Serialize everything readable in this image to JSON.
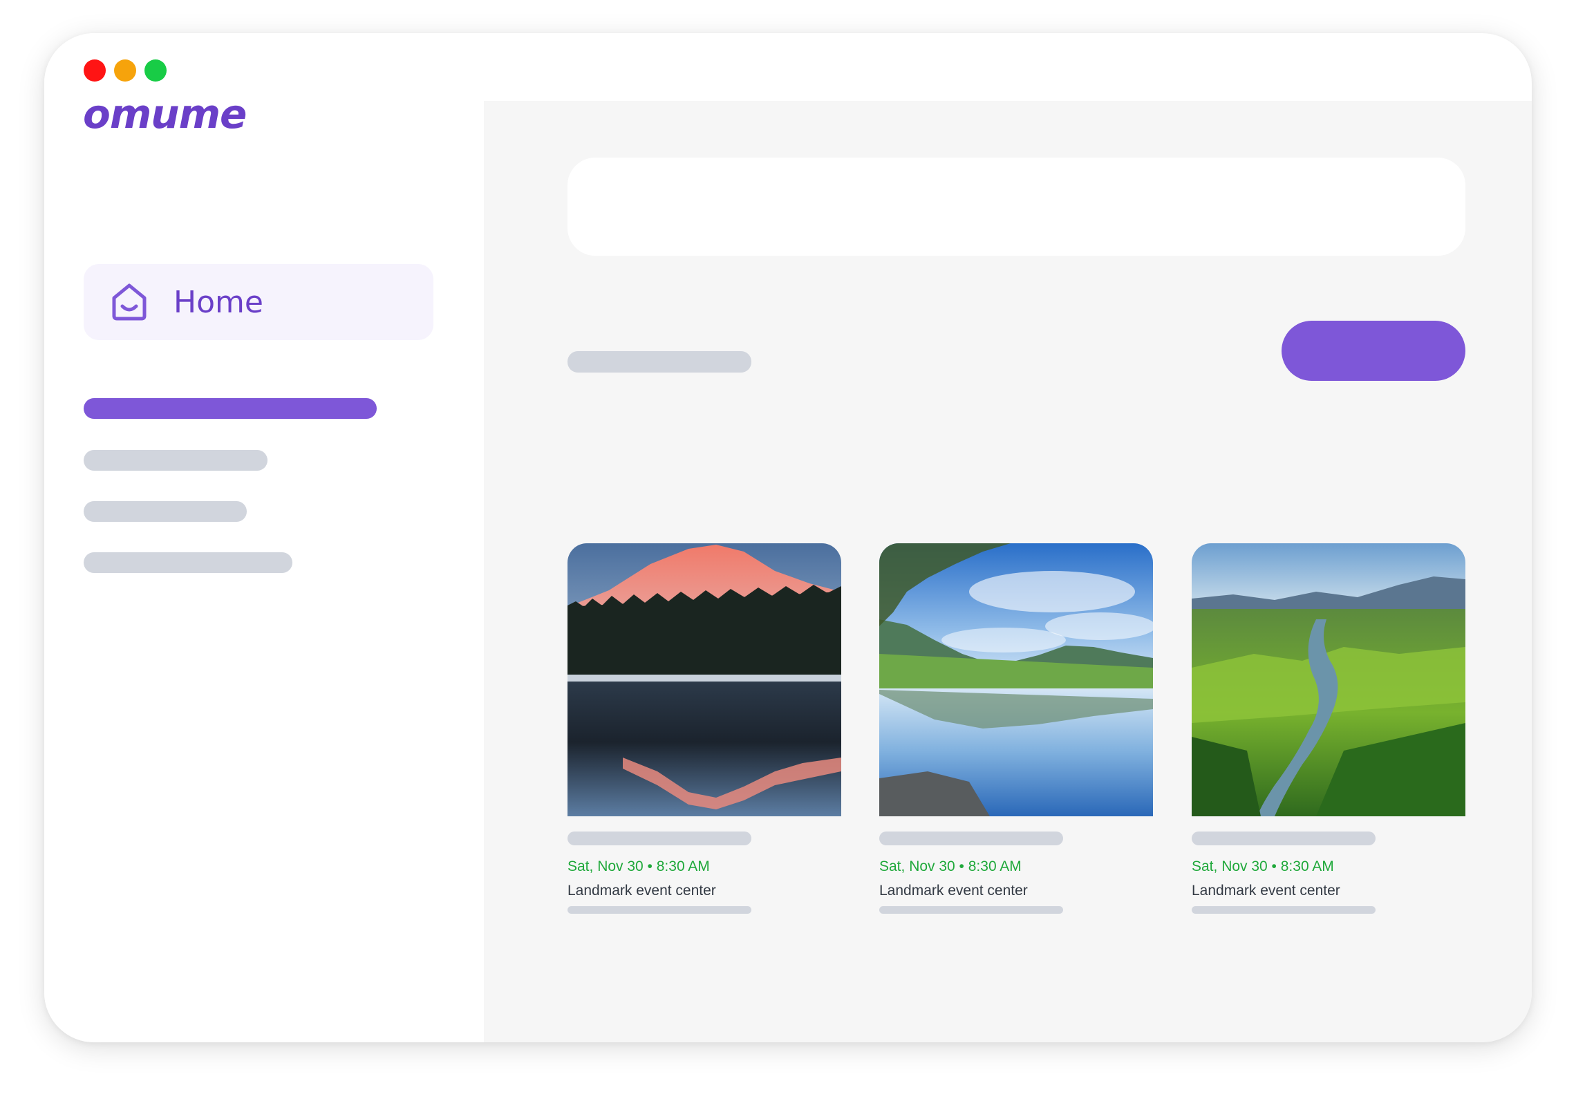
{
  "colors": {
    "brand": "#6a3fc8",
    "accent": "#7e57d8",
    "skeleton": "#d1d5dd",
    "main_bg": "#f6f6f6",
    "home_bg": "#f6f3fd",
    "date_green": "#1fa83a",
    "venue_text": "#333a44",
    "traffic_red": "#ff1414",
    "traffic_yellow": "#f6a30b",
    "traffic_green": "#18cc46"
  },
  "app": {
    "logo": "omume"
  },
  "sidebar": {
    "home": {
      "label": "Home",
      "icon": "home-smile-icon"
    }
  },
  "events": [
    {
      "date": "Sat, Nov 30 • 8:30 AM",
      "venue": "Landmark event center",
      "image": "snowy-mountain-lake-image"
    },
    {
      "date": "Sat, Nov 30 • 8:30 AM",
      "venue": "Landmark event center",
      "image": "mountain-lake-reflection-image"
    },
    {
      "date": "Sat, Nov 30 • 8:30 AM",
      "venue": "Landmark event center",
      "image": "green-valley-river-image"
    }
  ]
}
